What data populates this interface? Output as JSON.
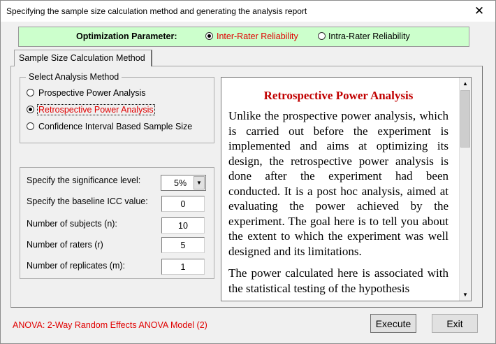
{
  "window": {
    "title": "Specifying the sample size calculation method and generating the analysis report",
    "close_glyph": "✕"
  },
  "optimization": {
    "label": "Optimization Parameter:",
    "options": [
      {
        "label": "Inter-Rater Reliability",
        "selected": true
      },
      {
        "label": "Intra-Rater Reliability",
        "selected": false
      }
    ]
  },
  "tab": {
    "label": "Sample Size Calculation Method"
  },
  "analysis_method": {
    "legend": "Select Analysis Method",
    "options": [
      {
        "label": "Prospective Power Analysis",
        "selected": false
      },
      {
        "label": "Retrospective Power Analysis",
        "selected": true
      },
      {
        "label": "Confidence Interval Based Sample Size",
        "selected": false
      }
    ]
  },
  "parameters": {
    "significance": {
      "label": "Specify the significance level:",
      "value": "5%"
    },
    "baseline_icc": {
      "label": "Specify the baseline ICC value:",
      "value": "0"
    },
    "subjects": {
      "label": "Number of subjects (n):",
      "value": "10"
    },
    "raters": {
      "label": "Number of raters (r)",
      "value": "5"
    },
    "replicates": {
      "label": "Number of replicates (m):",
      "value": "1"
    }
  },
  "description": {
    "title": "Retrospective Power Analysis",
    "paragraph1": "Unlike the prospective power analysis, which is carried out before the experi­ment is implemented and aims at opti­mizing its design, the retrospective power analysis is done after the experiment had been conducted. It is a post hoc analysis, aimed at evaluating the power achieved by the experiment. The goal here is to tell you about the extent to which the experiment was well designed and its lim­itations.",
    "paragraph2": "The power calculated here is associated with the statistical testing of the hypoth­esis"
  },
  "status": {
    "model_text": "ANOVA: 2-Way Random Effects ANOVA Model (2)"
  },
  "buttons": {
    "execute": "Execute",
    "exit": "Exit"
  },
  "icons": {
    "scroll_up": "▲",
    "scroll_down": "▼",
    "combo_arrow": "▼"
  },
  "colors": {
    "accent_red": "#e00000",
    "option_bar_bg": "#ccffcc",
    "title_red": "#c00000"
  }
}
